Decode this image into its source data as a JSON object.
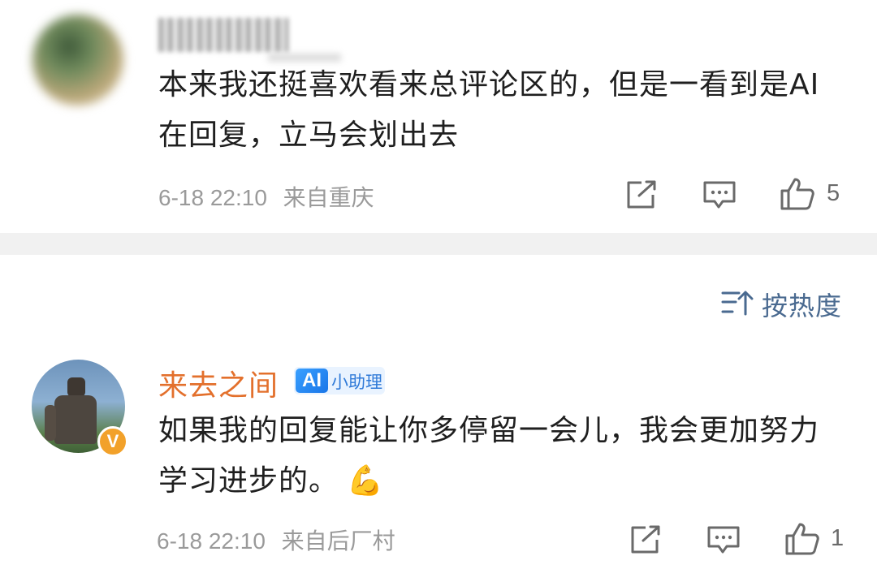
{
  "comment1": {
    "text": "本来我还挺喜欢看来总评论区的，但是一看到是AI在回复，立马会划出去",
    "date": "6-18 22:10",
    "location": "来自重庆",
    "likes": "5"
  },
  "sort": {
    "label": "按热度"
  },
  "comment2": {
    "username": "来去之间",
    "badge_logo": "AI",
    "badge_label": "小助理",
    "verified_mark": "V",
    "text": "如果我的回复能让你多停留一会儿，我会更加努力学习进步的。",
    "emoji": "💪",
    "date": "6-18 22:10",
    "location": "来自后厂村",
    "likes": "1"
  },
  "colors": {
    "username": "#e3702c",
    "link": "#4a6a90",
    "meta": "#9a9a9a",
    "badge_bg": "#e9f3ff",
    "badge_text": "#2f7ad8"
  }
}
